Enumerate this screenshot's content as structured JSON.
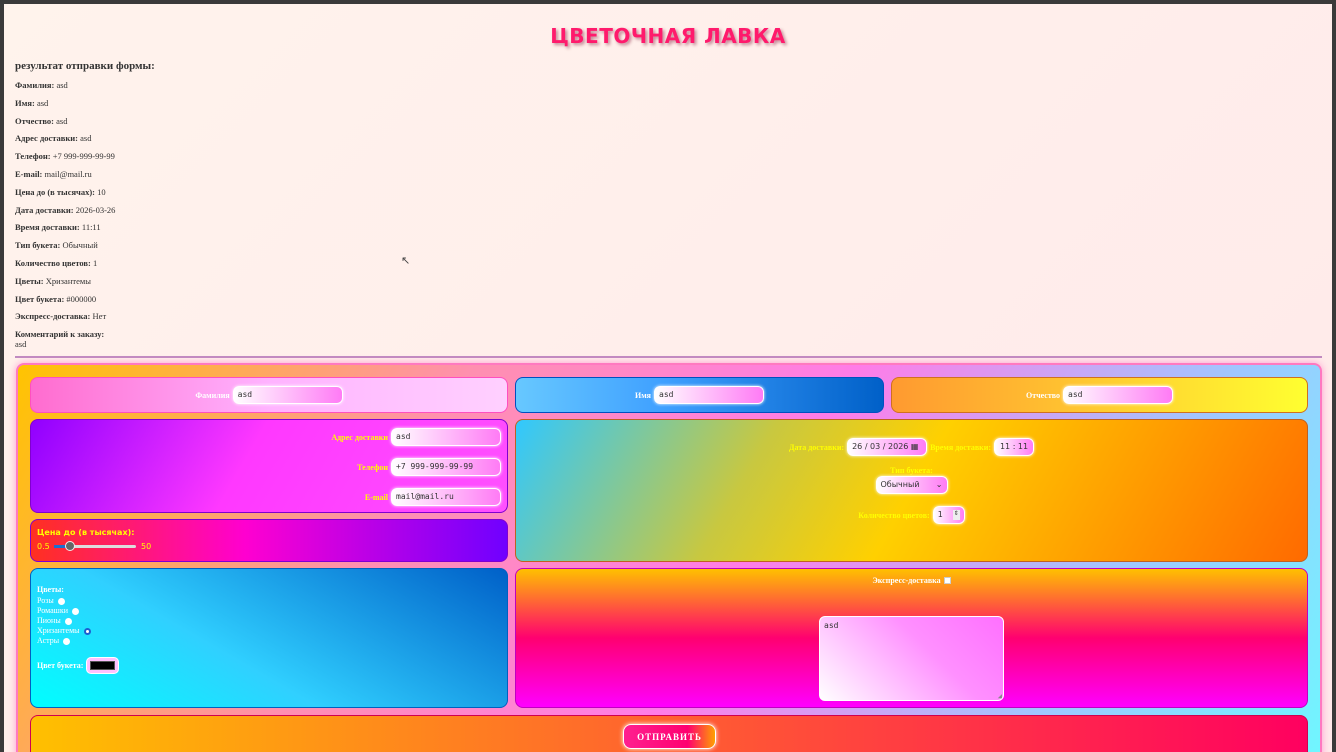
{
  "title": "ЦВЕТОЧНАЯ ЛАВКА",
  "result": {
    "heading": "результат отправки формы:",
    "items": [
      {
        "label": "Фамилия:",
        "value": "asd"
      },
      {
        "label": "Имя:",
        "value": "asd"
      },
      {
        "label": "Отчество:",
        "value": "asd"
      },
      {
        "label": "Адрес доставки:",
        "value": "asd"
      },
      {
        "label": "Телефон:",
        "value": "+7 999-999-99-99"
      },
      {
        "label": "E-mail:",
        "value": "mail@mail.ru"
      },
      {
        "label": "Цена до (в тысячах):",
        "value": "10"
      },
      {
        "label": "Дата доставки:",
        "value": "2026-03-26"
      },
      {
        "label": "Время доставки:",
        "value": "11:11"
      },
      {
        "label": "Тип букета:",
        "value": "Обычный"
      },
      {
        "label": "Количество цветов:",
        "value": "1"
      },
      {
        "label": "Цветы:",
        "value": "Хризантемы"
      },
      {
        "label": "Цвет букета:",
        "value": "#000000"
      },
      {
        "label": "Экспресс-доставка:",
        "value": "Нет"
      },
      {
        "label": "Комментарий к заказу:",
        "value": "asd"
      }
    ]
  },
  "form": {
    "surname": {
      "label": "Фамилия",
      "value": "asd"
    },
    "name": {
      "label": "Имя",
      "value": "asd"
    },
    "patronymic": {
      "label": "Отчество",
      "value": "asd"
    },
    "address": {
      "label": "Адрес доставки",
      "value": "asd"
    },
    "phone": {
      "label": "Телефон",
      "value": "+7 999-999-99-99"
    },
    "email": {
      "label": "E-mail",
      "value": "mail@mail.ru"
    },
    "price": {
      "label": "Цена до (в тысячах):",
      "min": "0.5",
      "max": "50",
      "value": 10
    },
    "date": {
      "label": "Дата доставки:",
      "value": "26 / 03 / 2026"
    },
    "time": {
      "label": "Время доставки:",
      "value": "11 : 11"
    },
    "type": {
      "label": "Тип букета:",
      "value": "Обычный"
    },
    "count": {
      "label": "Количество цветов:",
      "value": "1"
    },
    "flowers": {
      "label": "Цветы:",
      "options": [
        "Розы",
        "Ромашки",
        "Пионы",
        "Хризантемы",
        "Астры"
      ],
      "selected": 3
    },
    "color": {
      "label": "Цвет букета:",
      "value": "#000000"
    },
    "express": {
      "label": "Экспресс-доставка",
      "checked": false
    },
    "comment": {
      "value": "asd"
    },
    "submit": "ОТПРАВИТЬ"
  }
}
